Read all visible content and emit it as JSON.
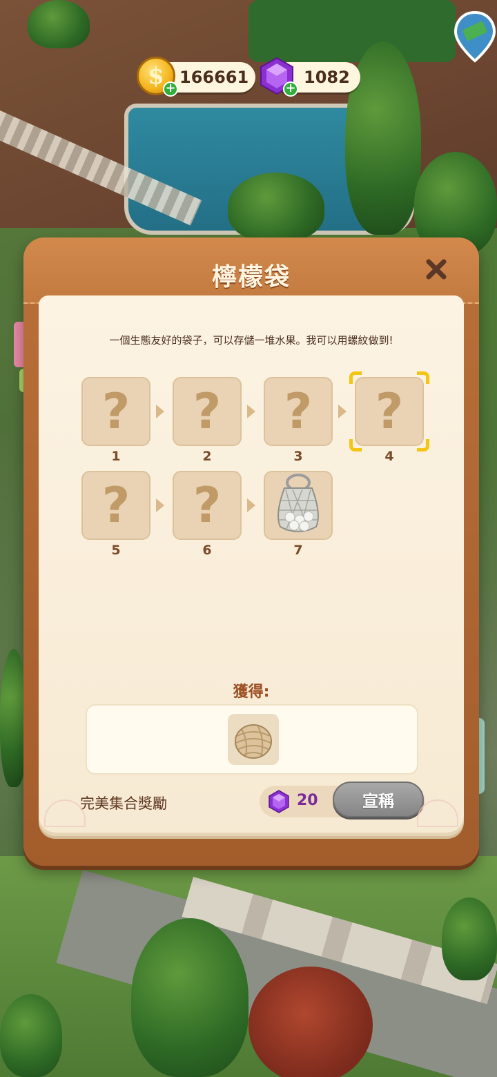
{
  "hud": {
    "coins": "166661",
    "gems": "1082",
    "coin_symbol": "$",
    "plus": "+"
  },
  "collection": {
    "title": "檸檬袋",
    "description": "一個生態友好的袋子，可以存儲一堆水果。我可以用螺紋做到!",
    "close_label": "✖",
    "steps": [
      {
        "number": "1",
        "state": "locked",
        "symbol": "?"
      },
      {
        "number": "2",
        "state": "locked",
        "symbol": "?"
      },
      {
        "number": "3",
        "state": "locked",
        "symbol": "?"
      },
      {
        "number": "4",
        "state": "selected",
        "symbol": "?"
      },
      {
        "number": "5",
        "state": "locked",
        "symbol": "?"
      },
      {
        "number": "6",
        "state": "locked",
        "symbol": "?"
      },
      {
        "number": "7",
        "state": "unlocked",
        "icon": "mesh-bag-icon"
      }
    ],
    "reward_label": "獲得:",
    "reward_item_icon": "twine-spool-icon",
    "perfect_set_label": "完美集合獎勵",
    "perfect_set_gems": "20",
    "claim_button_label": "宣稱"
  },
  "colors": {
    "panel_brown": "#b9703a",
    "page_cream": "#fcf3e3",
    "slot_tan": "#e9d3b4",
    "selection_yellow": "#f4c514",
    "claim_button_gray": "#858585",
    "gem_purple": "#9a3fd6"
  }
}
